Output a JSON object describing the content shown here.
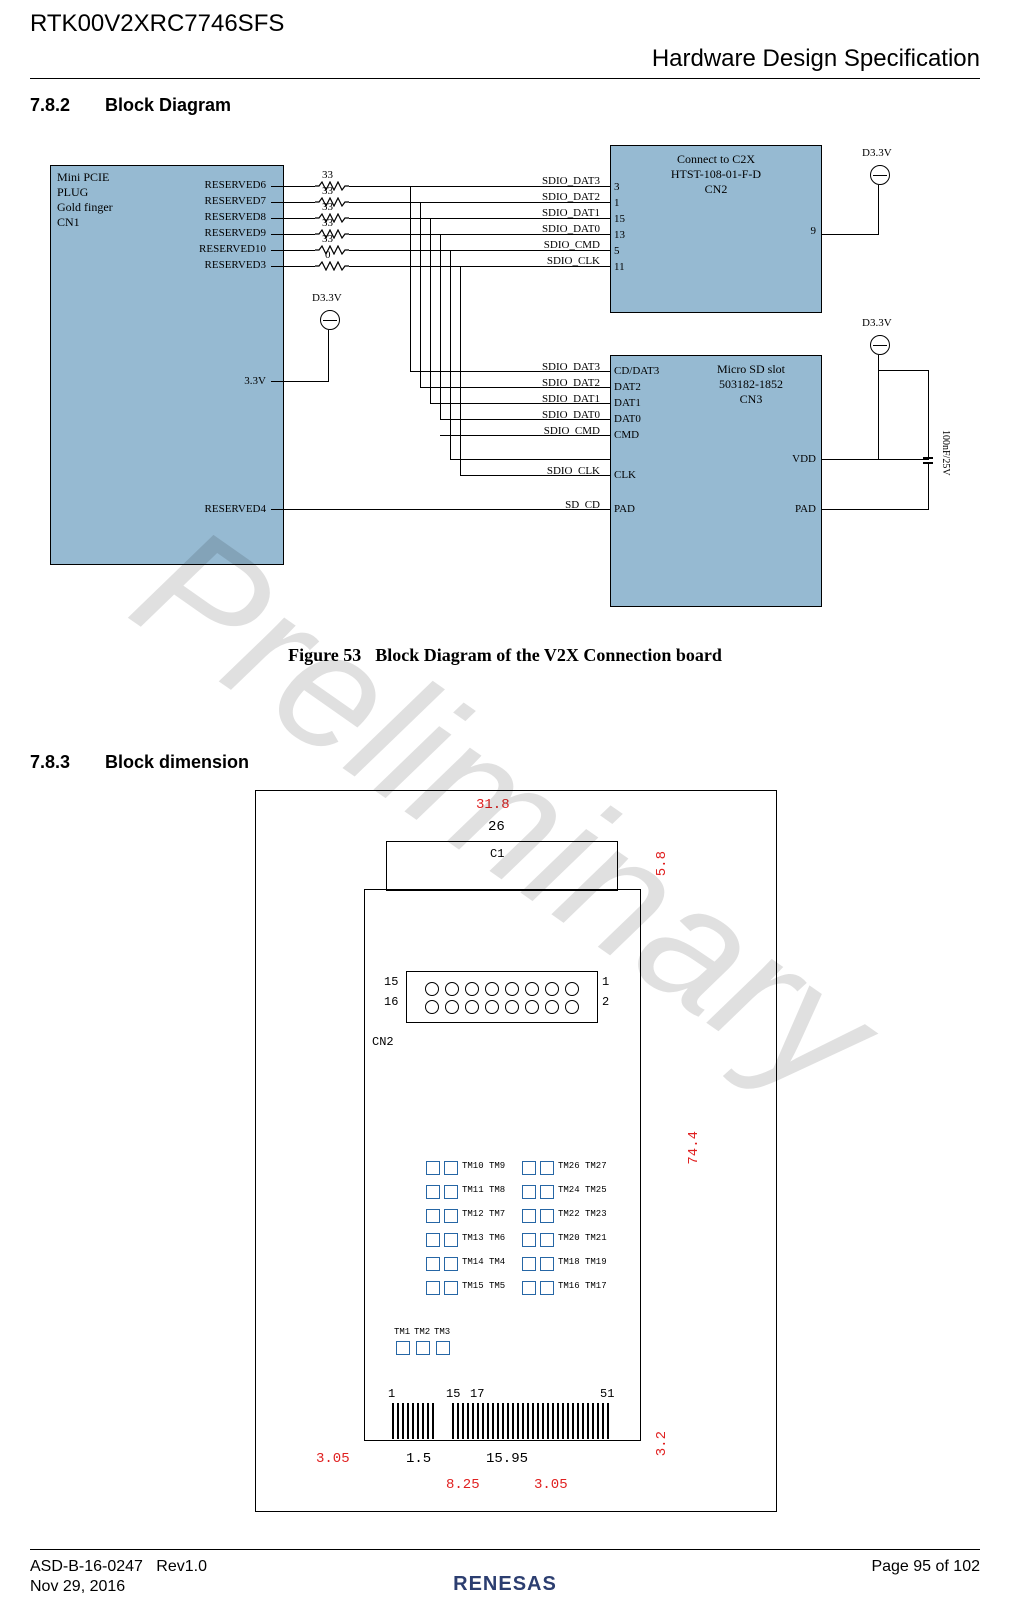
{
  "header": {
    "part_number": "RTK00V2XRC7746SFS",
    "doc_title": "Hardware Design Specification"
  },
  "section_782": {
    "number": "7.8.2",
    "title": "Block Diagram"
  },
  "section_783": {
    "number": "7.8.3",
    "title": "Block dimension"
  },
  "figure53": {
    "label": "Figure 53",
    "caption": "Block Diagram of the V2X Connection board"
  },
  "watermark": "Preliminary",
  "blockdiagram": {
    "box_cn1": {
      "line1": "Mini PCIE",
      "line2": "PLUG",
      "line3": "Gold finger",
      "line4": "CN1"
    },
    "box_cn2": {
      "line1": "Connect to C2X",
      "line2": "HTST-108-01-F-D",
      "line3": "CN2"
    },
    "box_cn3": {
      "line1": "Micro SD slot",
      "line2": "503182-1852",
      "line3": "CN3"
    },
    "cn1_pins": {
      "reserved6": "RESERVED6",
      "reserved7": "RESERVED7",
      "reserved8": "RESERVED8",
      "reserved9": "RESERVED9",
      "reserved10": "RESERVED10",
      "reserved3": "RESERVED3",
      "p3v3": "3.3V",
      "reserved4": "RESERVED4"
    },
    "res_values": {
      "r1": "33",
      "r2": "33",
      "r3": "33",
      "r4": "33",
      "r5": "33",
      "r6": "0"
    },
    "nets_top": {
      "dat3": "SDIO_DAT3",
      "dat2": "SDIO_DAT2",
      "dat1": "SDIO_DAT1",
      "dat0": "SDIO_DAT0",
      "cmd": "SDIO_CMD",
      "clk": "SDIO_CLK"
    },
    "cn2_pins": {
      "p3": "3",
      "p1": "1",
      "p15": "15",
      "p13": "13",
      "p5": "5",
      "p11": "11",
      "p9": "9"
    },
    "nets_bot": {
      "dat3": "SDIO_DAT3",
      "dat2": "SDIO_DAT2",
      "dat1": "SDIO_DAT1",
      "dat0": "SDIO_DAT0",
      "cmd": "SDIO_CMD",
      "clk": "SDIO_CLK",
      "cd": "SD_CD"
    },
    "cn3_pins": {
      "cddat3": "CD/DAT3",
      "dat2": "DAT2",
      "dat1": "DAT1",
      "dat0": "DAT0",
      "cmd": "CMD",
      "clk": "CLK",
      "pad_l": "PAD",
      "vdd": "VDD",
      "pad_r": "PAD"
    },
    "d3v3": "D3.3V",
    "cap_value": "100nF/25V"
  },
  "dimensions": {
    "w_outer": "31.8",
    "w_inner": "26",
    "h_conn": "5.8",
    "h_body": "74.4",
    "left_off": "3.05",
    "gf1": "1.5",
    "gf2": "15.95",
    "bot_h": "3.2",
    "bot1": "8.25",
    "bot2": "3.05",
    "cn2_label": "CN2",
    "cn2_1": "1",
    "cn2_2": "2",
    "cn2_15": "15",
    "cn2_16": "16",
    "gf_left": "1",
    "gf_15": "15",
    "gf_17": "17",
    "gf_51": "51",
    "c1": "C1",
    "tm_rows": [
      [
        "TM10",
        "TM9",
        "TM26",
        "TM27"
      ],
      [
        "TM11",
        "TM8",
        "TM24",
        "TM25"
      ],
      [
        "TM12",
        "TM7",
        "TM22",
        "TM23"
      ],
      [
        "TM13",
        "TM6",
        "TM20",
        "TM21"
      ],
      [
        "TM14",
        "TM4",
        "TM18",
        "TM19"
      ],
      [
        "TM15",
        "TM5",
        "TM16",
        "TM17"
      ]
    ],
    "tm_bottom": [
      "TM1",
      "TM2",
      "TM3"
    ]
  },
  "footer": {
    "docnum": "ASD-B-16-0247",
    "rev": "Rev1.0",
    "date": "Nov 29, 2016",
    "page_label": "Page",
    "page_cur": "95",
    "page_of": "of 102",
    "logo": "RENESAS"
  }
}
